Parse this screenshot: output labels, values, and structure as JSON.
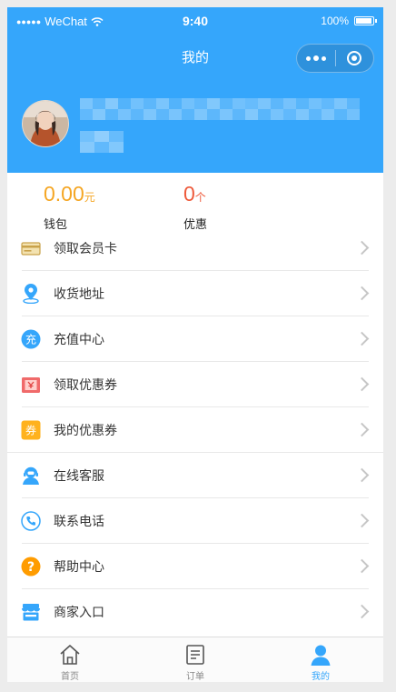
{
  "status_bar": {
    "carrier": "WeChat",
    "time": "9:40",
    "battery": "100%"
  },
  "nav": {
    "title": "我的"
  },
  "stats": {
    "wallet": {
      "value": "0.00",
      "unit": "元",
      "label": "钱包"
    },
    "coupon": {
      "value": "0",
      "unit": "个",
      "label": "优惠"
    }
  },
  "menu": [
    {
      "label": "领取会员卡",
      "icon": "member-card-icon"
    },
    {
      "label": "收货地址",
      "icon": "location-pin-icon"
    },
    {
      "label": "充值中心",
      "icon": "recharge-icon",
      "icon_text": "充"
    },
    {
      "label": "领取优惠券",
      "icon": "gift-coupon-icon"
    },
    {
      "label": "我的优惠券",
      "icon": "coupon-icon",
      "icon_text": "券"
    },
    {
      "label": "在线客服",
      "icon": "customer-service-icon"
    },
    {
      "label": "联系电话",
      "icon": "phone-icon"
    },
    {
      "label": "帮助中心",
      "icon": "help-icon",
      "icon_text": "?"
    },
    {
      "label": "商家入口",
      "icon": "store-icon"
    }
  ],
  "tabbar": [
    {
      "label": "首页",
      "icon": "home-icon"
    },
    {
      "label": "订单",
      "icon": "order-icon"
    },
    {
      "label": "我的",
      "icon": "profile-icon",
      "active": true
    }
  ],
  "colors": {
    "brand": "#35a6fb",
    "wallet": "#f5a623",
    "coupon": "#ee5a3b",
    "help": "#ff9c00"
  }
}
